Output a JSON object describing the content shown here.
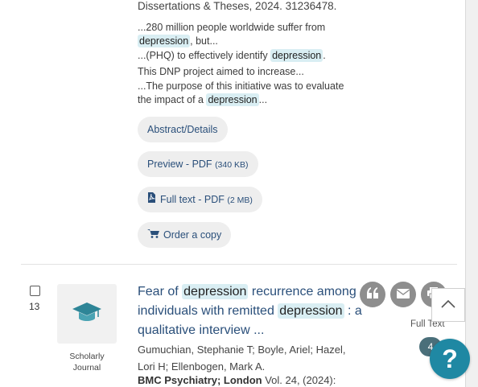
{
  "result1": {
    "source_line": "Dissertations & Theses,  2024. 31236478.",
    "snippets": [
      {
        "before": "...280 million people worldwide suffer from",
        "hl": "",
        "after": ""
      },
      {
        "before": "",
        "hl": "depression",
        "after": ", but..."
      },
      {
        "before": "...(PHQ) to effectively identify ",
        "hl": "depression",
        "after": "."
      },
      {
        "before": "This DNP project aimed to increase...",
        "hl": "",
        "after": ""
      },
      {
        "before": "...The purpose of this initiative was to evaluate",
        "hl": "",
        "after": ""
      },
      {
        "before": "the impact of a ",
        "hl": "depression",
        "after": "..."
      }
    ],
    "links": {
      "abstract": "Abstract/Details",
      "preview": "Preview - PDF",
      "preview_size": "(340 KB)",
      "fulltext": "Full text - PDF",
      "fulltext_size": "(2 MB)",
      "order": "Order a copy"
    }
  },
  "result2": {
    "number": "13",
    "doc_type": "Scholarly Journal",
    "title_part1": "Fear of ",
    "title_hl1": "depression",
    "title_part2": " recurrence among individuals with remitted ",
    "title_hl2": "depression",
    "title_part3": " : a qualitative interview  ...",
    "authors": "Gumuchian, Stephanie T; Boyle, Ariel; Hazel, Lori H; Ellenbogen, Mark A.",
    "journal": "BMC Psychiatry",
    "place": "; London",
    "volume": "Vol. 24,  (2024):",
    "fulltext_label": "Full Text",
    "fulltext_count": "4"
  },
  "icons": [
    "cite-icon",
    "email-icon",
    "print-icon",
    "back-to-top-icon",
    "help-icon",
    "pdf-icon",
    "cart-icon",
    "scholarly-journal-icon"
  ],
  "colors": {
    "link": "#2a4f7a",
    "highlight": "#d9eef3",
    "help": "#1f88a3",
    "badge": "#4a6f7a"
  }
}
